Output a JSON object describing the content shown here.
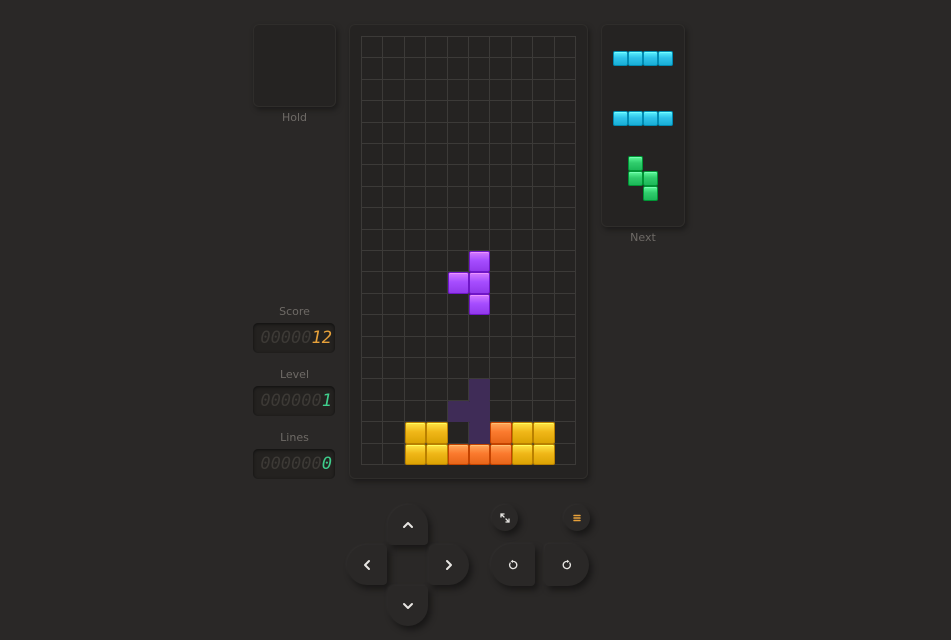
{
  "hold": {
    "label": "Hold"
  },
  "next": {
    "label": "Next"
  },
  "stats": {
    "score": {
      "label": "Score",
      "ghost": "00000",
      "value": "12",
      "color": "#e7a13a"
    },
    "level": {
      "label": "Level",
      "ghost": "000000",
      "value": "1",
      "color": "#3fce8c"
    },
    "lines": {
      "label": "Lines",
      "ghost": "000000",
      "value": "0",
      "color": "#3fce8c"
    }
  },
  "board": {
    "cols": 10,
    "rows": 20,
    "colors": {
      "T": "#a64dff",
      "O": "#f0b718",
      "L": "#fb7a2e",
      "ghost": "#3f2c57",
      "I": "#2ec3ea",
      "S": "#30cc6c"
    },
    "cells": [
      {
        "c": 5,
        "r": 10,
        "t": "T"
      },
      {
        "c": 4,
        "r": 11,
        "t": "T"
      },
      {
        "c": 5,
        "r": 11,
        "t": "T"
      },
      {
        "c": 5,
        "r": 12,
        "t": "T"
      },
      {
        "c": 5,
        "r": 16,
        "t": "ghost"
      },
      {
        "c": 4,
        "r": 17,
        "t": "ghost"
      },
      {
        "c": 5,
        "r": 17,
        "t": "ghost"
      },
      {
        "c": 5,
        "r": 18,
        "t": "ghost"
      },
      {
        "c": 2,
        "r": 18,
        "t": "O"
      },
      {
        "c": 3,
        "r": 18,
        "t": "O"
      },
      {
        "c": 6,
        "r": 18,
        "t": "L"
      },
      {
        "c": 7,
        "r": 18,
        "t": "O"
      },
      {
        "c": 8,
        "r": 18,
        "t": "O"
      },
      {
        "c": 2,
        "r": 19,
        "t": "O"
      },
      {
        "c": 3,
        "r": 19,
        "t": "O"
      },
      {
        "c": 4,
        "r": 19,
        "t": "L"
      },
      {
        "c": 5,
        "r": 19,
        "t": "L"
      },
      {
        "c": 6,
        "r": 19,
        "t": "L"
      },
      {
        "c": 7,
        "r": 19,
        "t": "O"
      },
      {
        "c": 8,
        "r": 19,
        "t": "O"
      }
    ]
  },
  "next_queue": [
    {
      "type": "I",
      "cells": [
        [
          0,
          0
        ],
        [
          1,
          0
        ],
        [
          2,
          0
        ],
        [
          3,
          0
        ]
      ]
    },
    {
      "type": "I",
      "cells": [
        [
          0,
          0
        ],
        [
          1,
          0
        ],
        [
          2,
          0
        ],
        [
          3,
          0
        ]
      ]
    },
    {
      "type": "S",
      "cells": [
        [
          0,
          0
        ],
        [
          0,
          1
        ],
        [
          1,
          1
        ],
        [
          1,
          2
        ]
      ]
    }
  ],
  "controls": {
    "up": "chevron-up-icon",
    "down": "chevron-down-icon",
    "left": "chevron-left-icon",
    "right": "chevron-right-icon",
    "rotate_left": "rotate-counterclockwise-icon",
    "rotate_right": "rotate-clockwise-icon",
    "fullscreen": "fullscreen-icon",
    "menu": "menu-icon",
    "menu_color": "#e7a13a"
  }
}
